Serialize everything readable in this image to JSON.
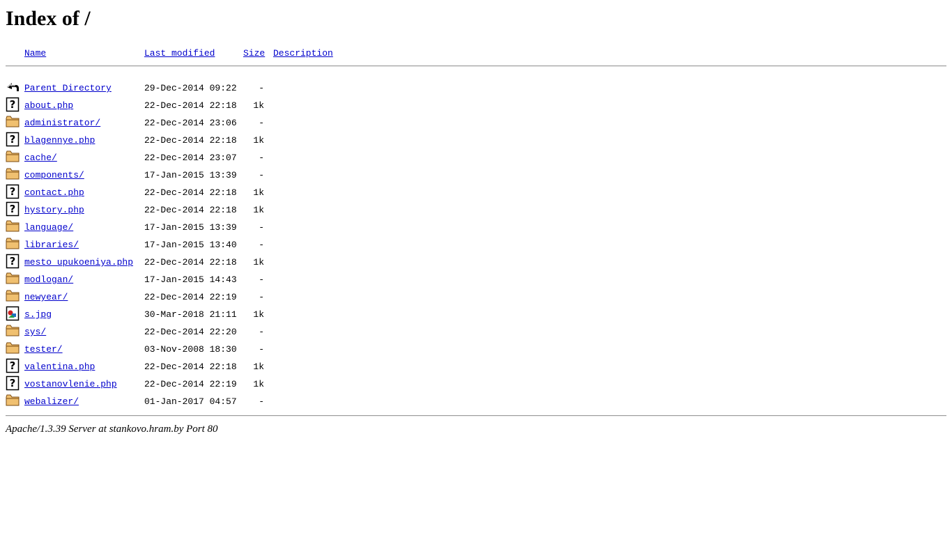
{
  "title": "Index of /",
  "columns": {
    "name": "Name",
    "last_modified": "Last modified",
    "size": "Size",
    "description": "Description"
  },
  "entries": [
    {
      "icon": "back-arrow-icon",
      "name": "Parent Directory",
      "date": "29-Dec-2014 09:22",
      "size": "-"
    },
    {
      "icon": "unknown-file-icon",
      "name": "about.php",
      "date": "22-Dec-2014 22:18",
      "size": "1k"
    },
    {
      "icon": "folder-icon",
      "name": "administrator/",
      "date": "22-Dec-2014 23:06",
      "size": "-"
    },
    {
      "icon": "unknown-file-icon",
      "name": "blagennye.php",
      "date": "22-Dec-2014 22:18",
      "size": "1k"
    },
    {
      "icon": "folder-icon",
      "name": "cache/",
      "date": "22-Dec-2014 23:07",
      "size": "-"
    },
    {
      "icon": "folder-icon",
      "name": "components/",
      "date": "17-Jan-2015 13:39",
      "size": "-"
    },
    {
      "icon": "unknown-file-icon",
      "name": "contact.php",
      "date": "22-Dec-2014 22:18",
      "size": "1k"
    },
    {
      "icon": "unknown-file-icon",
      "name": "hystory.php",
      "date": "22-Dec-2014 22:18",
      "size": "1k"
    },
    {
      "icon": "folder-icon",
      "name": "language/",
      "date": "17-Jan-2015 13:39",
      "size": "-"
    },
    {
      "icon": "folder-icon",
      "name": "libraries/",
      "date": "17-Jan-2015 13:40",
      "size": "-"
    },
    {
      "icon": "unknown-file-icon",
      "name": "mesto_upukoeniya.php",
      "date": "22-Dec-2014 22:18",
      "size": "1k"
    },
    {
      "icon": "folder-icon",
      "name": "modlogan/",
      "date": "17-Jan-2015 14:43",
      "size": "-"
    },
    {
      "icon": "folder-icon",
      "name": "newyear/",
      "date": "22-Dec-2014 22:19",
      "size": "-"
    },
    {
      "icon": "image-file-icon",
      "name": "s.jpg",
      "date": "30-Mar-2018 21:11",
      "size": "1k"
    },
    {
      "icon": "folder-icon",
      "name": "sys/",
      "date": "22-Dec-2014 22:20",
      "size": "-"
    },
    {
      "icon": "folder-icon",
      "name": "tester/",
      "date": "03-Nov-2008 18:30",
      "size": "-"
    },
    {
      "icon": "unknown-file-icon",
      "name": "valentina.php",
      "date": "22-Dec-2014 22:18",
      "size": "1k"
    },
    {
      "icon": "unknown-file-icon",
      "name": "vostanovlenie.php",
      "date": "22-Dec-2014 22:19",
      "size": "1k"
    },
    {
      "icon": "folder-icon",
      "name": "webalizer/",
      "date": "01-Jan-2017 04:57",
      "size": "-"
    }
  ],
  "footer": "Apache/1.3.39 Server at stankovo.hram.by Port 80"
}
